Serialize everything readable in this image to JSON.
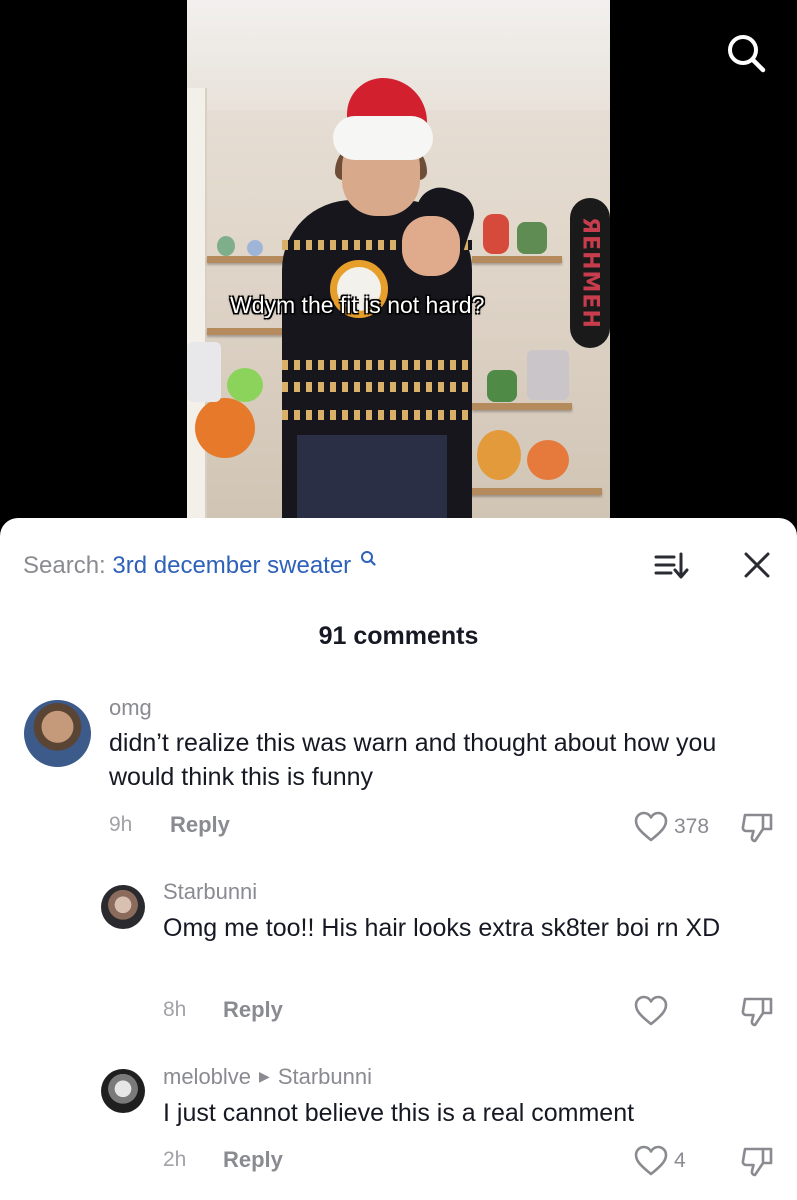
{
  "video": {
    "caption": "Wdym the fit is not hard?",
    "skateboard_text": "ЯEHMEH"
  },
  "header": {
    "search_prefix": "Search:",
    "search_query": "3rd december sweater",
    "icons": [
      "search-icon",
      "sort-icon",
      "close-icon"
    ]
  },
  "comments": {
    "count_label": "91 comments",
    "items": [
      {
        "username": "omg",
        "text": "didn’t realize this was warn and thought about how you would think this is funny",
        "time": "9h",
        "reply_label": "Reply",
        "likes": "378"
      },
      {
        "username": "Starbunni",
        "text": "Omg me too!! His hair looks extra sk8ter boi rn XD",
        "time": "8h",
        "reply_label": "Reply",
        "likes": ""
      },
      {
        "username": "meloblve",
        "reply_to": "Starbunni",
        "text": "I just cannot believe this is a real comment",
        "time": "2h",
        "reply_label": "Reply",
        "likes": "4"
      }
    ]
  },
  "colors": {
    "link_blue": "#2e61b9",
    "muted_gray": "#8a8b91",
    "text_dark": "#161823"
  }
}
